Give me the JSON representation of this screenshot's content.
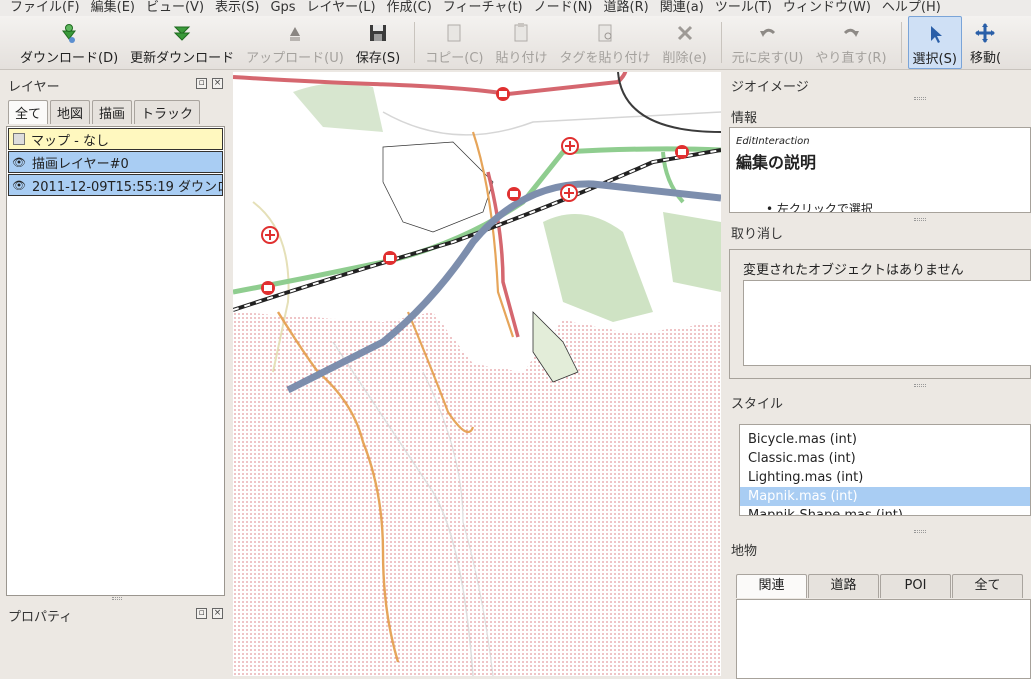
{
  "menu": [
    "ファイル(F)",
    "編集(E)",
    "ビュー(V)",
    "表示(S)",
    "Gps",
    "レイヤー(L)",
    "作成(C)",
    "フィーチャ(t)",
    "ノード(N)",
    "道路(R)",
    "関連(a)",
    "ツール(T)",
    "ウィンドウ(W)",
    "ヘルプ(H)"
  ],
  "toolbar": {
    "download": "ダウンロード(D)",
    "update_download": "更新ダウンロード",
    "upload": "アップロード(U)",
    "save": "保存(S)",
    "copy": "コピー(C)",
    "paste": "貼り付け",
    "paste_tags": "タグを貼り付け",
    "delete": "削除(e)",
    "undo": "元に戻す(U)",
    "redo": "やり直す(R)",
    "select": "選択(S)",
    "move": "移動("
  },
  "layers": {
    "title": "レイヤー",
    "tabs": [
      "全て",
      "地図",
      "描画",
      "トラック"
    ],
    "items": [
      {
        "label": "マップ - なし"
      },
      {
        "label": "描画レイヤー#0"
      },
      {
        "label": "2011-12-09T15:55:19 ダウンロ"
      }
    ]
  },
  "properties": {
    "title": "プロパティ"
  },
  "geoimage": {
    "title": "ジオイメージ"
  },
  "info": {
    "title": "情報",
    "small": "EditInteraction",
    "heading": "編集の説明",
    "bullet": "• 左クリックで選択"
  },
  "undo_panel": {
    "title": "取り消し",
    "message": "変更されたオブジェクトはありません"
  },
  "style": {
    "title": "スタイル",
    "items": [
      "Bicycle.mas (int)",
      "Classic.mas (int)",
      "Lighting.mas (int)",
      "Mapnik.mas (int)",
      "Mapnik-Shape.mas (int)"
    ]
  },
  "features": {
    "title": "地物",
    "tabs": [
      "関連",
      "道路",
      "POI",
      "全て"
    ]
  }
}
